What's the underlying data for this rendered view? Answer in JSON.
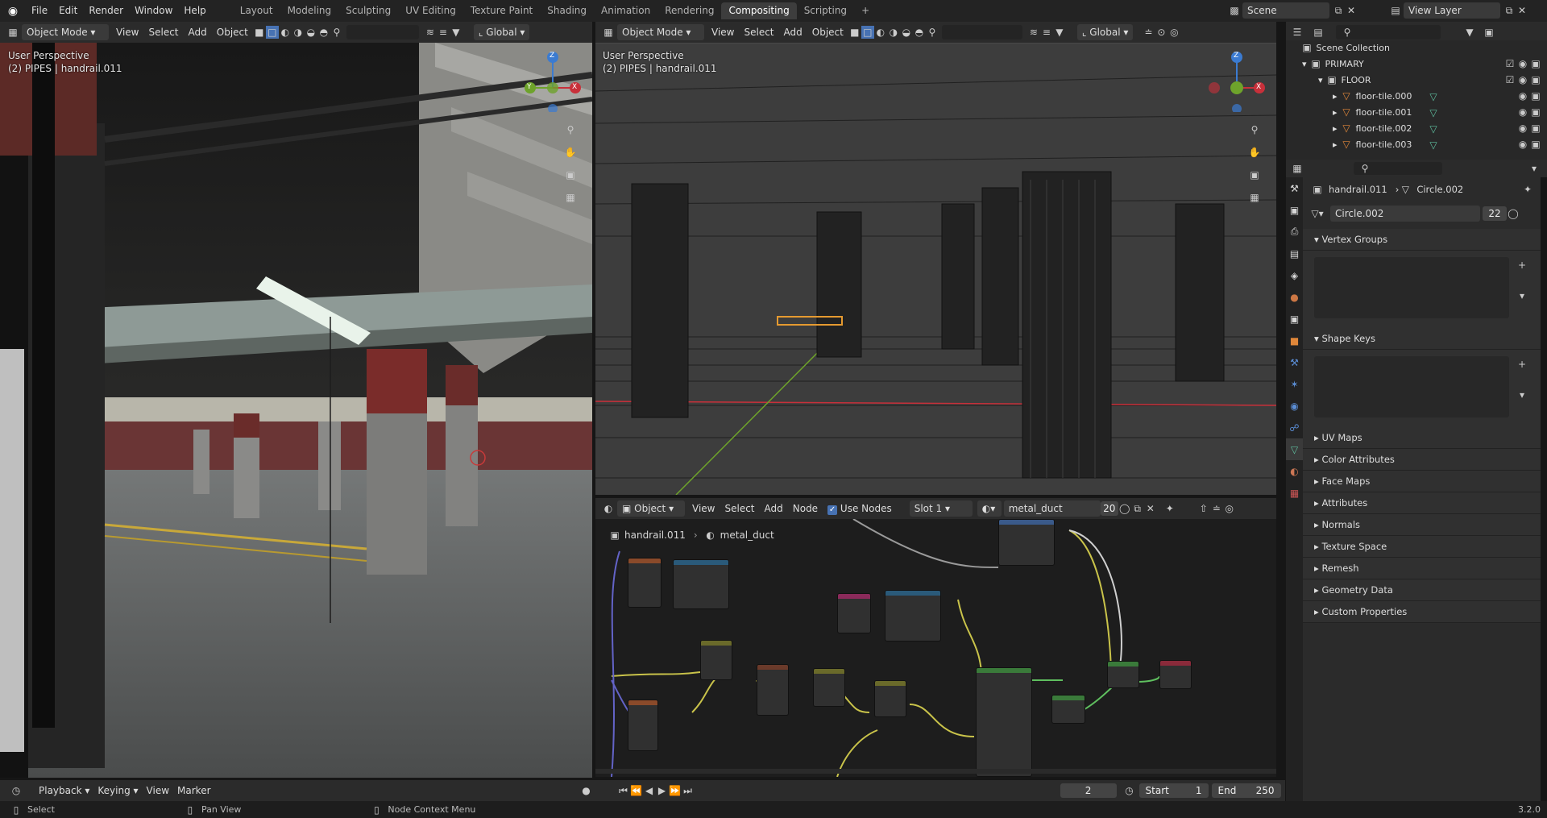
{
  "topbar": {
    "menus": [
      "File",
      "Edit",
      "Render",
      "Window",
      "Help"
    ],
    "workspaces": [
      "Layout",
      "Modeling",
      "Sculpting",
      "UV Editing",
      "Texture Paint",
      "Shading",
      "Animation",
      "Rendering",
      "Compositing",
      "Scripting"
    ],
    "active_workspace": "Compositing",
    "scene": "Scene",
    "view_layer": "View Layer"
  },
  "viewport_left": {
    "mode": "Object Mode",
    "menus": [
      "View",
      "Select",
      "Add",
      "Object"
    ],
    "orientation": "Global",
    "perspective": "User Perspective",
    "object": "(2) PIPES | handrail.011"
  },
  "viewport_right": {
    "mode": "Object Mode",
    "menus": [
      "View",
      "Select",
      "Add",
      "Object"
    ],
    "orientation": "Global",
    "perspective": "User Perspective",
    "object": "(2) PIPES | handrail.011"
  },
  "gizmo": {
    "x": "X",
    "y": "Y",
    "z": "Z"
  },
  "node_editor": {
    "mode": "Object",
    "menus": [
      "View",
      "Select",
      "Add",
      "Node"
    ],
    "use_nodes_label": "Use Nodes",
    "use_nodes": true,
    "slot": "Slot 1",
    "material": "metal_duct",
    "users": "20",
    "breadcrumb_object": "handrail.011",
    "breadcrumb_material": "metal_duct"
  },
  "outliner": {
    "root": "Scene Collection",
    "collection": "PRIMARY",
    "subcollection": "FLOOR",
    "items": [
      "floor-tile.000",
      "floor-tile.001",
      "floor-tile.002",
      "floor-tile.003"
    ]
  },
  "properties": {
    "object": "handrail.011",
    "mesh": "Circle.002",
    "mesh_field": "Circle.002",
    "mesh_users": "22",
    "vertex_groups": "Vertex Groups",
    "shape_keys": "Shape Keys",
    "panels": [
      "UV Maps",
      "Color Attributes",
      "Face Maps",
      "Attributes",
      "Normals",
      "Texture Space",
      "Remesh",
      "Geometry Data",
      "Custom Properties"
    ]
  },
  "timeline": {
    "menus": [
      "Playback",
      "Keying",
      "View",
      "Marker"
    ],
    "current_frame": "2",
    "start_label": "Start",
    "start": "1",
    "end_label": "End",
    "end": "250"
  },
  "status": {
    "select": "Select",
    "pan": "Pan View",
    "context": "Node Context Menu",
    "version": "3.2.0"
  },
  "colors": {
    "accent": "#4772b3",
    "wire": "#8a8a8a",
    "axis_red": "#c8303a",
    "axis_green": "#6ea32b",
    "axis_blue": "#3b7bd1",
    "node_link_yellow": "#c9c34a",
    "node_link_green": "#5fbf5f",
    "node_link_blue": "#6363c7"
  }
}
